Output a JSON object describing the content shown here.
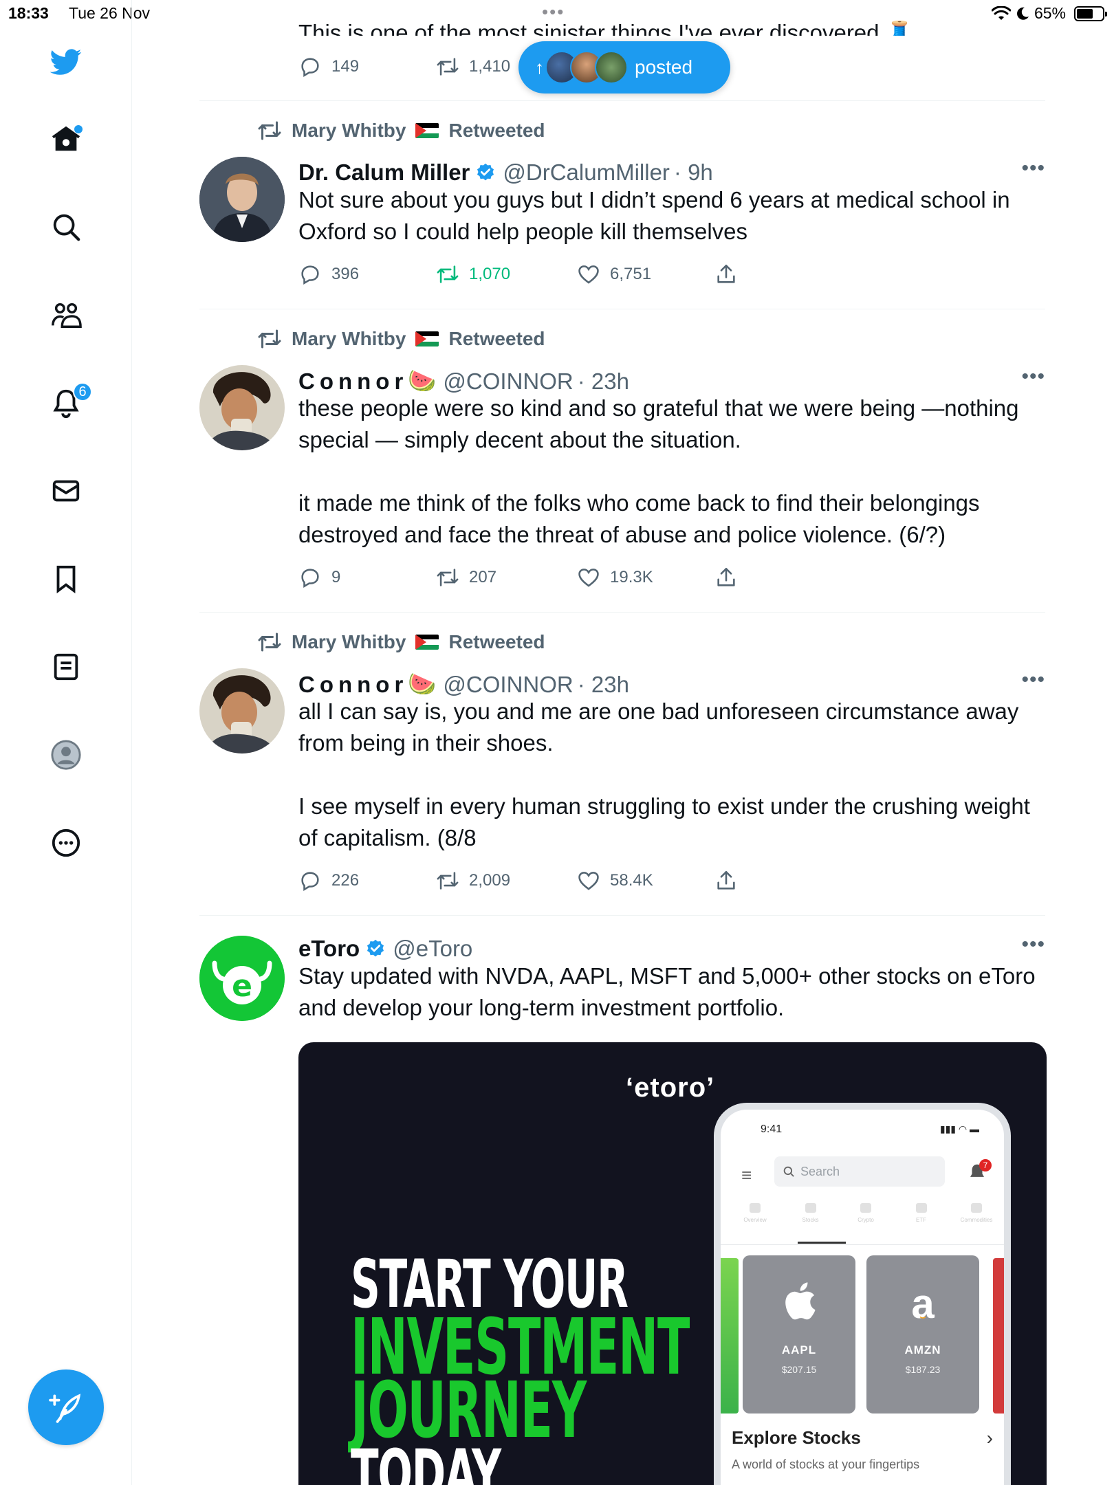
{
  "status_bar": {
    "time": "18:33",
    "date": "Tue 26 Nov",
    "battery": "65%",
    "battery_level": 0.65
  },
  "sidebar": {
    "notification_count": "6",
    "items": [
      {
        "name": "home",
        "icon": "home-icon"
      },
      {
        "name": "explore",
        "icon": "search-icon"
      },
      {
        "name": "communities",
        "icon": "communities-icon"
      },
      {
        "name": "notifications",
        "icon": "bell-icon"
      },
      {
        "name": "messages",
        "icon": "mail-icon"
      },
      {
        "name": "bookmarks",
        "icon": "bookmark-icon"
      },
      {
        "name": "lists",
        "icon": "list-icon"
      },
      {
        "name": "profile",
        "icon": "profile-icon"
      },
      {
        "name": "more",
        "icon": "more-circle-icon"
      }
    ],
    "compose_icon": "compose-feather-icon"
  },
  "partial_tweet": {
    "text": "This is one of the most sinister things I've ever discovered 🧵",
    "replies": "149",
    "retweets": "1,410"
  },
  "posted_pill": {
    "label": "posted"
  },
  "tweets": [
    {
      "retweeted_by": "Mary Whitby",
      "retweeted_label": "Retweeted",
      "name": "Dr. Calum Miller",
      "verified": true,
      "handle": "@DrCalumMiller",
      "time": "· 9h",
      "paragraphs": [
        "Not sure about you guys but I didn’t spend 6 years at medical school in Oxford so I could help people kill themselves"
      ],
      "replies": "396",
      "retweets": "1,070",
      "retweeted_by_me": true,
      "likes": "6,751"
    },
    {
      "retweeted_by": "Mary Whitby",
      "retweeted_label": "Retweeted",
      "name": "Connor",
      "name_emoji": "🍉",
      "verified": false,
      "handle": "@COINNOR",
      "time": "· 23h",
      "paragraphs": [
        "these people were so kind and so grateful that we were being —nothing special — simply decent about the situation.",
        "it made me think of the folks who come back to find their belongings destroyed and face the threat of abuse and police violence. (6/?)"
      ],
      "replies": "9",
      "retweets": "207",
      "retweeted_by_me": false,
      "likes": "19.3K"
    },
    {
      "retweeted_by": "Mary Whitby",
      "retweeted_label": "Retweeted",
      "name": "Connor",
      "name_emoji": "🍉",
      "verified": false,
      "handle": "@COINNOR",
      "time": "· 23h",
      "paragraphs": [
        "all I can say is, you and me are one bad unforeseen circumstance away from being in their shoes.",
        "I see myself in every human struggling to exist under the crushing weight of capitalism. (8/8"
      ],
      "replies": "226",
      "retweets": "2,009",
      "retweeted_by_me": false,
      "likes": "58.4K"
    }
  ],
  "ad": {
    "name": "eToro",
    "verified": true,
    "handle": "@eToro",
    "text": "Stay updated with NVDA, AAPL, MSFT and 5,000+ other stocks on eToro and develop your long-term investment portfolio.",
    "card": {
      "brand": "eToro",
      "headline": [
        "START YOUR",
        "INVESTMENT",
        "JOURNEY",
        "TODAY"
      ],
      "phone": {
        "time": "9:41",
        "search_placeholder": "Search",
        "bell_count": "7",
        "tabs": [
          "Overview",
          "Stocks",
          "Crypto",
          "ETF",
          "Commodities"
        ],
        "stocks": [
          {
            "symbol": "AAPL",
            "price": "$207.15",
            "logo": "apple-logo-icon"
          },
          {
            "symbol": "AMZN",
            "price": "$187.23",
            "logo": "amazon-logo-icon"
          }
        ],
        "explore_title": "Explore Stocks",
        "explore_subtitle": "A world of stocks at your fingertips"
      }
    }
  },
  "colors": {
    "accent": "#1d9bf0",
    "retweet_green": "#00ba7c",
    "muted": "#536471",
    "etoro_green": "#13c636",
    "ad_background": "#12131f"
  }
}
